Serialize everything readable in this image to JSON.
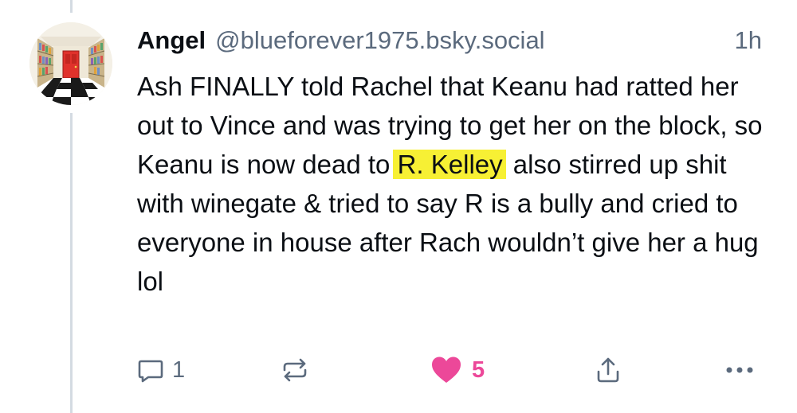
{
  "post": {
    "author_name": "Angel",
    "author_handle": "@blueforever1975.bsky.social",
    "timestamp": "1h",
    "text_before_highlight": "Ash FINALLY told Rachel that Keanu had ratted her out to Vince and was trying to get her on the block, so Keanu is now dead to ",
    "highlighted_text": "R. Kelley",
    "text_after_highlight": " also stirred up shit with winegate & tried to say R is a bully and cried to everyone in house after Rach wouldn’t give her a hug lol",
    "highlight_color": "#f7f034"
  },
  "actions": {
    "reply_count": "1",
    "like_count": "5",
    "like_color": "#ec4899",
    "icons": [
      "reply-icon",
      "repost-icon",
      "heart-icon",
      "share-icon",
      "more-icon"
    ]
  }
}
